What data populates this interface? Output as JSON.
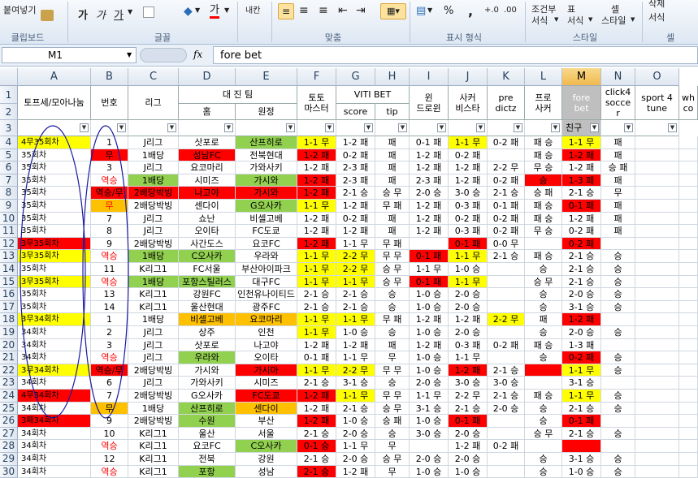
{
  "ribbon": {
    "clipboard": {
      "paste_format": "붙여넣기",
      "group": "클립보드"
    },
    "font": {
      "group": "글꼴",
      "b1": "가",
      "b2": "가",
      "b3": "가",
      "color_a": "가"
    },
    "align": {
      "group": "맞춤",
      "wrap": "내칸"
    },
    "number": {
      "group": "표시 형식",
      "percent": "%",
      "comma": ","
    },
    "style": {
      "group": "스타일",
      "cond": "조건부",
      "cond2": "서식",
      "table": "표",
      "table2": "서식",
      "cell": "셀",
      "cell2": "스타일"
    },
    "cells": {
      "group": "셀",
      "format": "서식",
      "delete": "삭제"
    }
  },
  "formula_bar": {
    "name_box": "M1",
    "fx": "fx",
    "value": "fore  bet"
  },
  "columns": [
    "A",
    "B",
    "C",
    "D",
    "E",
    "F",
    "G",
    "H",
    "I",
    "J",
    "K",
    "L",
    "M",
    "N",
    "O"
  ],
  "header": {
    "A": "토프세/모아나눔",
    "B": "번호",
    "C": "리그",
    "DE": "대 진 팀",
    "D2": "홈",
    "E2": "원정",
    "F": "토토\n마스터",
    "GH": "VITI  BET",
    "G2": "score",
    "H2": "tip",
    "I": "윈\n드로윈",
    "J": "사커\n비스타",
    "K": "pre\ndictz",
    "L": "프로\n사커",
    "M": "fore\nbet",
    "N": "click4\nsocce\nr",
    "O": "sport  4\ntune",
    "P": "wh\nco"
  },
  "filter_row": {
    "M": "친구"
  },
  "rows": [
    {
      "n": "4",
      "a": "4무35회차",
      "b": "1",
      "c": "J리그",
      "d": "삿포로",
      "e": "산프히로",
      "f": "1-1 무",
      "g": "1-2 패",
      "h": "패",
      "i": "0-1 패",
      "j": "1-1 무",
      "k": "0-2 패",
      "l": "패 승",
      "m": "1-1 무",
      "nn": "패"
    },
    {
      "n": "5",
      "a": "35회차",
      "b": "무",
      "c": "1배당",
      "d": "성남FC",
      "e": "전북현대",
      "f": "1-2 패",
      "g": "0-2 패",
      "h": "패",
      "i": "1-2 패",
      "j": "0-2 패",
      "k": "",
      "l": "패 승",
      "m": "1-2 패",
      "nn": "패"
    },
    {
      "n": "6",
      "a": "35회차",
      "b": "3",
      "c": "J리그",
      "d": "요코마리",
      "e": "가와사키",
      "f": "1-2 패",
      "g": "2-3 패",
      "h": "패",
      "i": "1-2 패",
      "j": "1-2 패",
      "k": "2-2 무",
      "l": "무 승",
      "m": "1-2 패",
      "nn": "승 패"
    },
    {
      "n": "7",
      "a": "35회차",
      "b": "역승",
      "c": "1배당",
      "d": "시미즈",
      "e": "가시와",
      "f": "1-2 패",
      "g": "2-3 패",
      "h": "패",
      "i": "2-3 패",
      "j": "1-2 패",
      "k": "0-2 패",
      "l": "승",
      "m": "1-3 패",
      "nn": "패"
    },
    {
      "n": "8",
      "a": "35회차",
      "b": "역승/무",
      "c": "2배당박빙",
      "d": "나고야",
      "e": "가시와",
      "f": "1-2 패",
      "g": "2-1 승",
      "h": "승 무",
      "i": "2-0 승",
      "j": "3-0 승",
      "k": "2-1 승",
      "l": "승 패",
      "m": "2-1 승",
      "nn": "무"
    },
    {
      "n": "9",
      "a": "35회차",
      "b": "무",
      "c": "2배당박빙",
      "d": "센다이",
      "e": "G오사카",
      "f": "1-1 무",
      "g": "1-2 패",
      "h": "무 패",
      "i": "1-2 패",
      "j": "0-3 패",
      "k": "0-1 패",
      "l": "패 승",
      "m": "0-1 패",
      "nn": "패"
    },
    {
      "n": "10",
      "a": "35회차",
      "b": "7",
      "c": "J리그",
      "d": "쇼난",
      "e": "비셀고베",
      "f": "1-2 패",
      "g": "0-2 패",
      "h": "패",
      "i": "1-2 패",
      "j": "0-2 패",
      "k": "0-2 패",
      "l": "패 승",
      "m": "1-2 패",
      "nn": "패"
    },
    {
      "n": "11",
      "a": "35회차",
      "b": "8",
      "c": "J리그",
      "d": "오이타",
      "e": "FC도쿄",
      "f": "1-2 패",
      "g": "1-2 패",
      "h": "패",
      "i": "1-2 패",
      "j": "0-3 패",
      "k": "0-2 패",
      "l": "무 승",
      "m": "0-2 패",
      "nn": "패"
    },
    {
      "n": "12",
      "a": "3무35회차",
      "b": "9",
      "c": "2배당박빙",
      "d": "사간도스",
      "e": "요코FC",
      "f": "1-2 패",
      "g": "1-1 무",
      "h": "무 패",
      "i": "",
      "j": "0-1 패",
      "k": "0-0 무",
      "l": "",
      "m": "0-2 패",
      "nn": ""
    },
    {
      "n": "13",
      "a": "3무35회차",
      "b": "역승",
      "c": "1배당",
      "d": "C오사카",
      "e": "우라와",
      "f": "1-1 무",
      "g": "2-2 무",
      "h": "무 무",
      "i": "0-1 패",
      "j": "1-1 무",
      "k": "2-1 승",
      "l": "패 승",
      "m": "2-1 승",
      "nn": "승"
    },
    {
      "n": "14",
      "a": "35회차",
      "b": "11",
      "c": "K리그1",
      "d": "FC서울",
      "e": "부산아이파크",
      "f": "1-1 무",
      "g": "2-2 무",
      "h": "승 무",
      "i": "1-1 무",
      "j": "1-0 승",
      "k": "",
      "l": "승",
      "m": "2-1 승",
      "nn": "승"
    },
    {
      "n": "15",
      "a": "3무35회차",
      "b": "역승",
      "c": "1배당",
      "d": "포항스틸러스",
      "e": "대구FC",
      "f": "1-1 무",
      "g": "1-1 무",
      "h": "승 무",
      "i": "0-1 패",
      "j": "1-1 무",
      "k": "",
      "l": "승 무",
      "m": "2-1 승",
      "nn": "승"
    },
    {
      "n": "16",
      "a": "35회차",
      "b": "13",
      "c": "K리그1",
      "d": "강원FC",
      "e": "인천유나이티드",
      "f": "2-1 승",
      "g": "2-1 승",
      "h": "승",
      "i": "1-0 승",
      "j": "2-0 승",
      "k": "",
      "l": "승",
      "m": "2-0 승",
      "nn": "승"
    },
    {
      "n": "17",
      "a": "35회차",
      "b": "14",
      "c": "K리그1",
      "d": "울산현대",
      "e": "광주FC",
      "f": "2-1 승",
      "g": "2-1 승",
      "h": "승",
      "i": "1-0 승",
      "j": "2-0 승",
      "k": "",
      "l": "승",
      "m": "3-1 승",
      "nn": "승"
    },
    {
      "n": "18",
      "a": "3무34회차",
      "b": "1",
      "c": "1배당",
      "d": "비셀고베",
      "e": "요코마리",
      "f": "1-1 무",
      "g": "1-1 무",
      "h": "무 패",
      "i": "1-2 패",
      "j": "1-2 패",
      "k": "2-2 무",
      "l": "패",
      "m": "1-2 패",
      "nn": ""
    },
    {
      "n": "19",
      "a": "34회차",
      "b": "2",
      "c": "J리그",
      "d": "상주",
      "e": "인천",
      "f": "1-1 무",
      "g": "1-0 승",
      "h": "승",
      "i": "1-0 승",
      "j": "2-0 승",
      "k": "",
      "l": "승",
      "m": "2-0 승",
      "nn": "승"
    },
    {
      "n": "20",
      "a": "34회차",
      "b": "3",
      "c": "J리그",
      "d": "삿포로",
      "e": "나고야",
      "f": "1-2 패",
      "g": "1-2 패",
      "h": "패",
      "i": "1-2 패",
      "j": "0-3 패",
      "k": "0-2 패",
      "l": "패 승",
      "m": "1-3 패",
      "nn": ""
    },
    {
      "n": "21",
      "a": "34회차",
      "b": "역승",
      "c": "J리그",
      "d": "우라와",
      "e": "오이타",
      "f": "0-1 패",
      "g": "1-1 무",
      "h": "무",
      "i": "1-0 승",
      "j": "1-1 무",
      "k": "",
      "l": "승",
      "m": "0-2 패",
      "nn": "승"
    },
    {
      "n": "22",
      "a": "3무34회차",
      "b": "역승/무",
      "c": "2배당박빙",
      "d": "가시와",
      "e": "가시마",
      "f": "1-1 무",
      "g": "2-2 무",
      "h": "무 무",
      "i": "1-0 승",
      "j": "1-2 패",
      "k": "2-1 승",
      "l": "",
      "m": "1-1 무",
      "nn": "승"
    },
    {
      "n": "23",
      "a": "34회차",
      "b": "6",
      "c": "J리그",
      "d": "가와사키",
      "e": "시미즈",
      "f": "2-1 승",
      "g": "3-1 승",
      "h": "승",
      "i": "2-0 승",
      "j": "3-0 승",
      "k": "3-0 승",
      "l": "",
      "m": "3-1 승",
      "nn": ""
    },
    {
      "n": "24",
      "a": "4무34회차",
      "b": "7",
      "c": "2배당박빙",
      "d": "G오사카",
      "e": "FC도쿄",
      "f": "1-2 패",
      "g": "1-1 무",
      "h": "무 무",
      "i": "1-1 무",
      "j": "2-2 무",
      "k": "2-1 승",
      "l": "패 승",
      "m": "1-1 무",
      "nn": "승"
    },
    {
      "n": "25",
      "a": "34회차",
      "b": "무",
      "c": "1배당",
      "d": "산프히로",
      "e": "센다이",
      "f": "1-2 패",
      "g": "2-1 승",
      "h": "승 무",
      "i": "3-1 승",
      "j": "2-1 승",
      "k": "2-0 승",
      "l": "승",
      "m": "2-1 승",
      "nn": "승"
    },
    {
      "n": "26",
      "a": "3패34회차",
      "b": "9",
      "c": "2배당박빙",
      "d": "수원",
      "e": "부산",
      "f": "1-2 패",
      "g": "1-0 승",
      "h": "승 패",
      "i": "1-0 승",
      "j": "0-1 패",
      "k": "",
      "l": "승",
      "m": "0-1 패",
      "nn": ""
    },
    {
      "n": "27",
      "a": "34회차",
      "b": "10",
      "c": "K리그1",
      "d": "울산",
      "e": "서울",
      "f": "2-1 승",
      "g": "2-0 승",
      "h": "승",
      "i": "3-0 승",
      "j": "2-0 승",
      "k": "",
      "l": "승 무",
      "m": "2-1 승",
      "nn": "승"
    },
    {
      "n": "28",
      "a": "34회차",
      "b": "역승",
      "c": "K리그1",
      "d": "요코FC",
      "e": "C오사카",
      "f": "0-1 승",
      "g": "1-1 무",
      "h": "무",
      "i": "",
      "j": "1-2 패",
      "k": "0-2 패",
      "l": "",
      "m": "",
      "nn": ""
    },
    {
      "n": "29",
      "a": "34회차",
      "b": "12",
      "c": "K리그1",
      "d": "전북",
      "e": "강원",
      "f": "2-1 승",
      "g": "2-0 승",
      "h": "승 무",
      "i": "2-0 승",
      "j": "2-0 승",
      "k": "",
      "l": "승",
      "m": "3-1 승",
      "nn": "승"
    },
    {
      "n": "30",
      "a": "34회차",
      "b": "역승",
      "c": "K리그1",
      "d": "포항",
      "e": "성남",
      "f": "2-1 승",
      "g": "1-2 패",
      "h": "무",
      "i": "1-0 승",
      "j": "1-0 승",
      "k": "",
      "l": "승",
      "m": "1-0 승",
      "nn": "승"
    }
  ]
}
